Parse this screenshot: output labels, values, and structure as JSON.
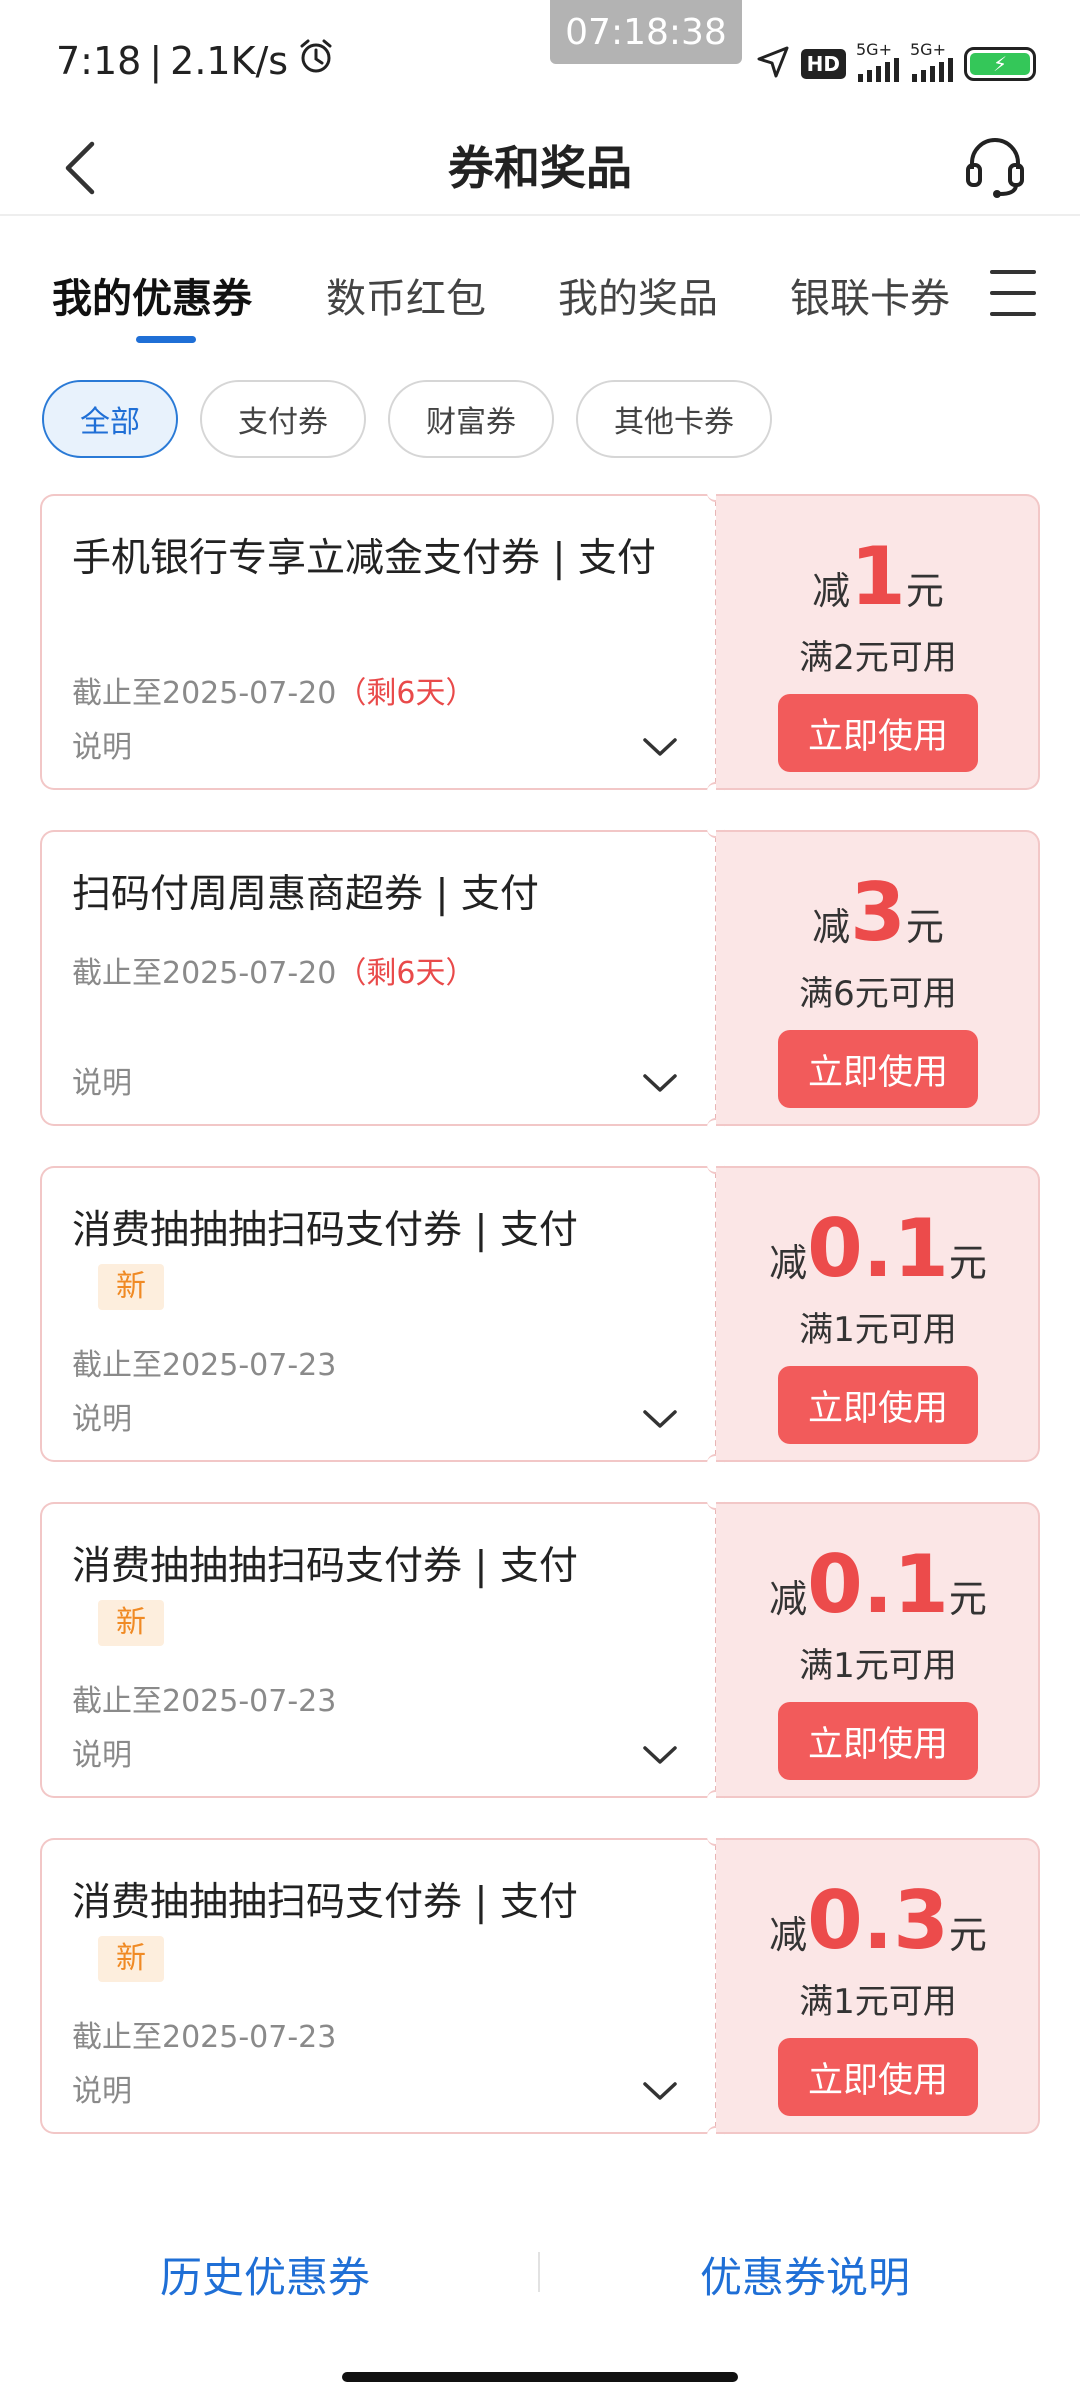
{
  "status_bar": {
    "time": "7:18",
    "separator": "|",
    "speed": "2.1K/s",
    "clock_overlay": "07:18:38",
    "hd": "HD",
    "net1": "5G+",
    "net2": "5G+"
  },
  "header": {
    "title": "券和奖品"
  },
  "tabs": [
    {
      "label": "我的优惠券"
    },
    {
      "label": "数币红包"
    },
    {
      "label": "我的奖品"
    },
    {
      "label": "银联卡券"
    }
  ],
  "filters": [
    {
      "label": "全部"
    },
    {
      "label": "支付券"
    },
    {
      "label": "财富券"
    },
    {
      "label": "其他卡券"
    }
  ],
  "coupons": [
    {
      "title": "手机银行专享立减金支付券 | 支付",
      "expire": "截止至2025-07-20",
      "remain": "（剩6天）",
      "desc": "说明",
      "prefix": "减",
      "amount": "1",
      "unit": "元",
      "condition": "满2元可用",
      "button": "立即使用"
    },
    {
      "title": "扫码付周周惠商超券 | 支付",
      "expire": "截止至2025-07-20",
      "remain": "（剩6天）",
      "desc": "说明",
      "prefix": "减",
      "amount": "3",
      "unit": "元",
      "condition": "满6元可用",
      "button": "立即使用"
    },
    {
      "title": "消费抽抽抽扫码支付券 | 支付",
      "badge": "新",
      "expire": "截止至2025-07-23",
      "desc": "说明",
      "prefix": "减",
      "amount": "0.1",
      "unit": "元",
      "condition": "满1元可用",
      "button": "立即使用"
    },
    {
      "title": "消费抽抽抽扫码支付券 | 支付",
      "badge": "新",
      "expire": "截止至2025-07-23",
      "desc": "说明",
      "prefix": "减",
      "amount": "0.1",
      "unit": "元",
      "condition": "满1元可用",
      "button": "立即使用"
    },
    {
      "title": "消费抽抽抽扫码支付券 | 支付",
      "badge": "新",
      "expire": "截止至2025-07-23",
      "desc": "说明",
      "prefix": "减",
      "amount": "0.3",
      "unit": "元",
      "condition": "满1元可用",
      "button": "立即使用"
    }
  ],
  "footer": {
    "history": "历史优惠券",
    "help": "优惠券说明"
  },
  "colors": {
    "accent_blue": "#1f6fd6",
    "coupon_red": "#ec4b4b",
    "button_red": "#f25b5b",
    "coupon_bg": "#fbe6e6",
    "badge_orange": "#f08a24"
  }
}
